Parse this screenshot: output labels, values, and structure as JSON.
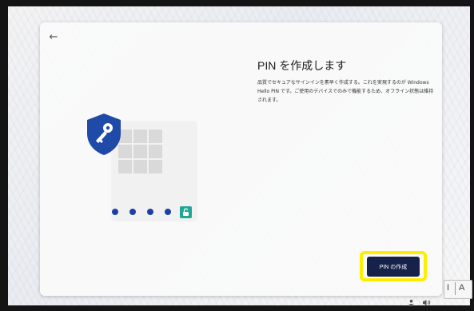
{
  "window": {
    "title": "PIN を作成します",
    "description": "品質でセキュアなサインインを素早く作成する。これを実現するのが Windows Hello PIN です。ご使用のデバイスでのみで機能するため、オフライン状態は維持されます。",
    "back_symbol": "←"
  },
  "actions": {
    "create_pin_label": "PIN の作成"
  },
  "illustration": {
    "pin_dot_count": 4,
    "shield_color": "#1f4aa8",
    "dot_color": "#1a40a8",
    "lock_badge_color": "#1fa796"
  },
  "taskbar": {
    "ime_indicator": "A",
    "ime_mode_label": "I",
    "icons": [
      "person-icon",
      "volume-icon"
    ]
  },
  "highlight": {
    "target": "create-pin-button",
    "color": "#ffee00"
  }
}
